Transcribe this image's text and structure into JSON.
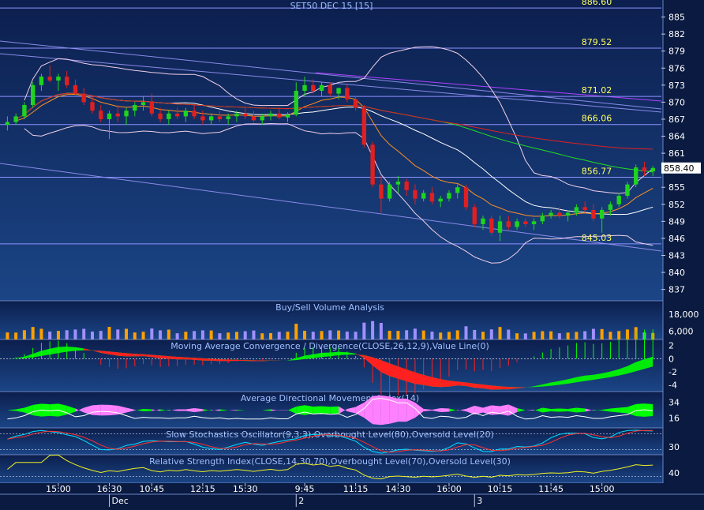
{
  "title": "SET50 DEC 15   [15]",
  "colors": {
    "background_top": "#0a1a40",
    "background_bottom": "#1e4a8c",
    "up_candle": "#1fd41f",
    "down_candle": "#e02020",
    "level_line": "#9090ff",
    "level_text": "#ffff60",
    "axis_text": "#ffffff",
    "macd_pos": "#00ff00",
    "macd_neg": "#ff2020",
    "adx_pos": "#00ff00",
    "adx_neg": "#ff80ff",
    "volume_up": "#ffa000",
    "volume_down": "#a090ff"
  },
  "chart_data": [
    {
      "panel": "price",
      "type": "candlestick",
      "title": "SET50 DEC 15   [15]",
      "current_price": "858.40",
      "ylim": [
        835,
        888
      ],
      "y_ticks": [
        "885",
        "882",
        "879",
        "876",
        "873",
        "870",
        "867",
        "864",
        "861",
        "858",
        "855",
        "852",
        "849",
        "846",
        "843",
        "840",
        "837"
      ],
      "horizontal_levels": [
        {
          "value": 886.6,
          "label": "886.60"
        },
        {
          "value": 879.52,
          "label": "879.52"
        },
        {
          "value": 871.02,
          "label": "871.02"
        },
        {
          "value": 866.06,
          "label": "866.06"
        },
        {
          "value": 856.77,
          "label": "856.77"
        },
        {
          "value": 845.03,
          "label": "845.03"
        }
      ],
      "candles": [
        [
          866.0,
          867.5,
          865.0,
          866.5
        ],
        [
          866.5,
          868.0,
          866.0,
          867.5
        ],
        [
          867.5,
          870.0,
          867.0,
          869.5
        ],
        [
          869.5,
          873.5,
          869.0,
          873.0
        ],
        [
          873.0,
          875.0,
          872.0,
          874.5
        ],
        [
          874.5,
          876.5,
          873.5,
          873.8
        ],
        [
          873.8,
          875.0,
          872.0,
          874.5
        ],
        [
          874.5,
          875.5,
          872.5,
          873.0
        ],
        [
          873.0,
          874.0,
          871.0,
          871.5
        ],
        [
          871.5,
          872.5,
          869.5,
          870.0
        ],
        [
          870.0,
          871.0,
          868.0,
          868.5
        ],
        [
          868.5,
          869.5,
          866.5,
          867.0
        ],
        [
          867.0,
          868.5,
          863.5,
          868.0
        ],
        [
          868.0,
          869.5,
          866.5,
          867.5
        ],
        [
          867.5,
          869.0,
          866.0,
          868.5
        ],
        [
          868.5,
          870.0,
          867.5,
          869.5
        ],
        [
          869.5,
          871.0,
          868.5,
          870.0
        ],
        [
          870.0,
          871.5,
          867.5,
          868.0
        ],
        [
          868.0,
          869.0,
          866.5,
          867.0
        ],
        [
          867.0,
          868.5,
          866.0,
          868.0
        ],
        [
          868.0,
          869.0,
          867.0,
          867.5
        ],
        [
          867.5,
          869.0,
          866.5,
          868.5
        ],
        [
          868.5,
          869.5,
          867.0,
          867.5
        ],
        [
          867.5,
          868.5,
          866.0,
          866.8
        ],
        [
          866.8,
          868.0,
          866.0,
          867.5
        ],
        [
          867.5,
          868.5,
          866.5,
          867.0
        ],
        [
          867.0,
          868.0,
          866.0,
          867.5
        ],
        [
          867.5,
          868.5,
          866.5,
          868.0
        ],
        [
          868.0,
          869.0,
          867.0,
          867.5
        ],
        [
          867.5,
          868.5,
          866.5,
          866.8
        ],
        [
          866.8,
          868.0,
          866.0,
          867.5
        ],
        [
          867.5,
          868.5,
          866.8,
          868.0
        ],
        [
          868.0,
          869.0,
          867.0,
          867.3
        ],
        [
          867.3,
          868.2,
          866.5,
          867.8
        ],
        [
          867.8,
          873.5,
          867.5,
          872.0
        ],
        [
          872.0,
          874.5,
          871.0,
          873.0
        ],
        [
          873.0,
          874.0,
          871.5,
          872.0
        ],
        [
          872.0,
          873.5,
          871.0,
          873.0
        ],
        [
          873.0,
          873.5,
          871.0,
          871.5
        ],
        [
          871.5,
          872.5,
          870.5,
          872.5
        ],
        [
          872.5,
          873.0,
          870.0,
          870.5
        ],
        [
          870.5,
          871.0,
          868.5,
          869.0
        ],
        [
          869.0,
          869.5,
          862.0,
          862.5
        ],
        [
          862.5,
          863.0,
          855.0,
          855.5
        ],
        [
          855.5,
          857.0,
          850.5,
          853.0
        ],
        [
          853.0,
          856.0,
          852.5,
          855.5
        ],
        [
          855.5,
          857.0,
          854.0,
          856.0
        ],
        [
          856.0,
          856.5,
          853.5,
          854.5
        ],
        [
          854.5,
          855.5,
          852.0,
          853.0
        ],
        [
          853.0,
          854.5,
          852.5,
          854.0
        ],
        [
          854.0,
          855.0,
          852.0,
          852.5
        ],
        [
          852.5,
          853.5,
          851.5,
          853.0
        ],
        [
          853.0,
          854.5,
          852.5,
          854.0
        ],
        [
          854.0,
          855.5,
          853.0,
          855.0
        ],
        [
          855.0,
          855.5,
          851.0,
          851.5
        ],
        [
          851.5,
          852.0,
          848.0,
          848.5
        ],
        [
          848.5,
          850.0,
          847.5,
          849.5
        ],
        [
          849.5,
          850.0,
          846.5,
          847.0
        ],
        [
          847.0,
          850.0,
          845.5,
          849.0
        ],
        [
          849.0,
          850.0,
          847.5,
          848.0
        ],
        [
          848.0,
          849.5,
          847.5,
          849.0
        ],
        [
          849.0,
          849.5,
          848.0,
          848.5
        ],
        [
          848.5,
          849.5,
          847.5,
          849.0
        ],
        [
          849.0,
          850.5,
          848.5,
          850.0
        ],
        [
          850.0,
          851.0,
          849.5,
          850.5
        ],
        [
          850.5,
          851.5,
          849.5,
          850.0
        ],
        [
          850.0,
          851.0,
          849.0,
          850.5
        ],
        [
          850.5,
          852.0,
          850.0,
          851.5
        ],
        [
          851.5,
          852.5,
          850.5,
          851.0
        ],
        [
          851.0,
          852.0,
          849.0,
          849.5
        ],
        [
          849.5,
          851.5,
          847.0,
          851.0
        ],
        [
          851.0,
          852.5,
          850.0,
          852.0
        ],
        [
          852.0,
          854.0,
          851.5,
          853.5
        ],
        [
          853.5,
          856.0,
          853.0,
          855.5
        ],
        [
          855.5,
          859.0,
          855.0,
          858.5
        ],
        [
          858.5,
          859.5,
          857.0,
          857.8
        ],
        [
          857.8,
          858.8,
          857.0,
          858.4
        ]
      ]
    },
    {
      "panel": "volume",
      "type": "bar",
      "title": "Buy/Sell Volume Analysis",
      "y_ticks": [
        "18,000",
        "6,000"
      ],
      "ylim": [
        0,
        27000
      ]
    },
    {
      "panel": "macd",
      "type": "area",
      "title": "Moving Average Convergence / Divergence(CLOSE,26,12,9),Value Line(0)",
      "y_ticks": [
        "2",
        "0",
        "-2",
        "-4"
      ],
      "ylim": [
        -5,
        2.8
      ]
    },
    {
      "panel": "adx",
      "type": "area",
      "title": "Average Directional Movement Index(14)",
      "y_ticks": [
        "34",
        "16"
      ],
      "ylim": [
        5,
        45
      ]
    },
    {
      "panel": "stochastic",
      "type": "line",
      "title": "Slow Stochastics Oscillator(9,3,3),Overbought Level(80),Oversold Level(20)",
      "y_ticks": [
        "30"
      ],
      "ylim": [
        0,
        100
      ]
    },
    {
      "panel": "rsi",
      "type": "line",
      "title": "Relative Strength Index(CLOSE,14,30,70),Overbought Level(70),Oversold Level(30)",
      "y_ticks": [
        "40"
      ],
      "ylim": [
        10,
        90
      ]
    }
  ],
  "time_axis": {
    "labels": [
      "15:00",
      "16:30",
      "10:45",
      "12:15",
      "15:30",
      "9:45",
      "11:15",
      "14:30",
      "16:00",
      "10:15",
      "11:45",
      "15:00"
    ],
    "label_index": [
      6,
      12,
      17,
      23,
      28,
      35,
      41,
      46,
      52,
      58,
      64,
      70
    ],
    "day_markers": [
      {
        "label": "Dec",
        "index": 12
      },
      {
        "label": "2",
        "index": 34
      },
      {
        "label": "3",
        "index": 55
      }
    ]
  }
}
